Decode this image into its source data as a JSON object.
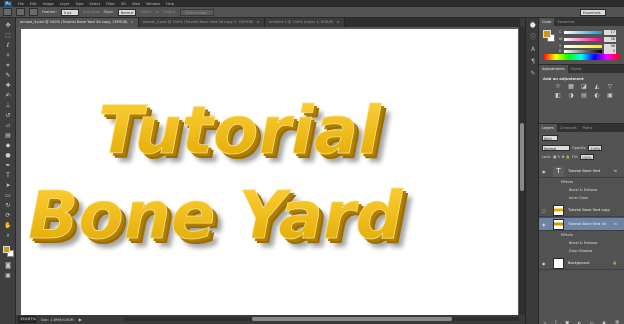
{
  "menubar": {
    "logo": "Ps",
    "items": [
      "File",
      "Edit",
      "Image",
      "Layer",
      "Type",
      "Select",
      "Filter",
      "3D",
      "View",
      "Window",
      "Help"
    ]
  },
  "options": {
    "feather_label": "Feather:",
    "feather_value": "0 px",
    "antialias_label": "Anti-alias",
    "style_label": "Style:",
    "style_value": "Normal",
    "width_label": "Width:",
    "height_label": "Height:",
    "refine_label": "Refine Edge...",
    "workspace": "Essentials"
  },
  "tabs": [
    {
      "label": "almost_4.psd @ 100% (Tutorial Bone Yard 3d copy, CMYK/8)",
      "active": true
    },
    {
      "label": "almost_3.psd @ 100% (Tutorial Bone Yard 3d copy 2, CMYK/8)",
      "active": false
    },
    {
      "label": "Untitled-1 @ 100% (Layer 1, RGB/8)",
      "active": false
    }
  ],
  "artwork": {
    "line1": "Tutorial",
    "line2": "Bone Yard",
    "fill_top": "#ffd23a",
    "fill_bottom": "#e0a800",
    "extrude": "#9c6e00"
  },
  "status": {
    "zoom": "194.67%",
    "doc": "Doc: 1.69M/4.60M",
    "arrow": "▶"
  },
  "color_panel": {
    "tab_color": "Color",
    "tab_swatches": "Swatches",
    "channels": [
      {
        "name": "C",
        "value": "17"
      },
      {
        "name": "M",
        "value": "38"
      },
      {
        "name": "Y",
        "value": "96"
      },
      {
        "name": "K",
        "value": "0"
      }
    ],
    "fg_color": "#c89a16"
  },
  "adjustments": {
    "tab_adjustments": "Adjustments",
    "tab_styles": "Styles",
    "heading": "Add an adjustment",
    "icons": [
      "☼",
      "▦",
      "◪",
      "◭",
      "▽",
      "◧",
      "◑",
      "▤",
      "◐",
      "▣"
    ]
  },
  "layers": {
    "tab_layers": "Layers",
    "tab_channels": "Channels",
    "tab_paths": "Paths",
    "filter_label": "Kind",
    "blend": "Normal",
    "opacity_label": "Opacity:",
    "opacity_value": "100%",
    "lock_label": "Lock:",
    "fill_label": "Fill:",
    "fill_value": "100%",
    "items": [
      {
        "name": "Tutorial Bone Yard",
        "type": "text",
        "fx": "fx",
        "selected": false
      },
      {
        "name": "Tutorial Bone Yard copy",
        "type": "raster",
        "fx": "",
        "selected": false
      },
      {
        "name": "Tutorial Bone Yard 3d",
        "type": "raster",
        "fx": "fx",
        "selected": true
      },
      {
        "name": "Background",
        "type": "bg",
        "fx": "",
        "selected": false
      }
    ],
    "effects_1": [
      "Effects",
      "Bevel & Emboss",
      "Inner Glow"
    ],
    "effects_3": [
      "Effects",
      "Bevel & Emboss",
      "Drop Shadow"
    ]
  }
}
